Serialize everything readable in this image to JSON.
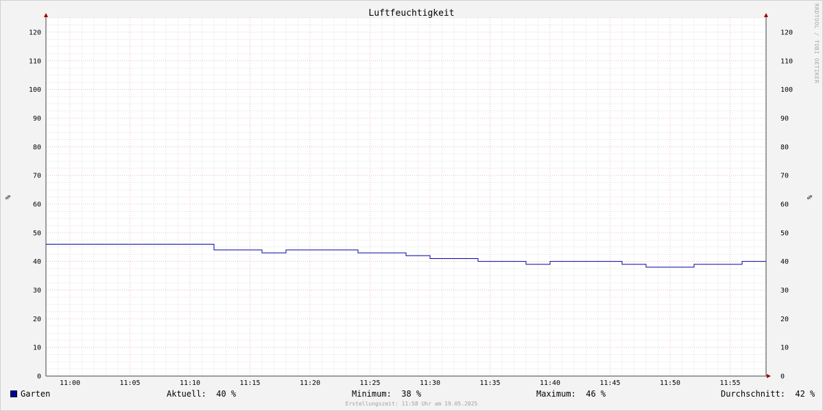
{
  "chart_data": {
    "type": "line",
    "title": "Luftfeuchtigkeit",
    "ylabel": "%",
    "ylabel_right": "%",
    "ylim": [
      0,
      125
    ],
    "yticks": [
      0,
      10,
      20,
      30,
      40,
      50,
      60,
      70,
      80,
      90,
      100,
      110,
      120
    ],
    "xlim": [
      "10:58",
      "11:58"
    ],
    "xticks": [
      "11:00",
      "11:05",
      "11:10",
      "11:15",
      "11:20",
      "11:25",
      "11:30",
      "11:35",
      "11:40",
      "11:45",
      "11:50",
      "11:55"
    ],
    "grid": true,
    "series": [
      {
        "name": "Garten",
        "color": "#0000a0",
        "step": true,
        "x": [
          "10:58",
          "11:12",
          "11:14",
          "11:16",
          "11:18",
          "11:24",
          "11:28",
          "11:30",
          "11:34",
          "11:38",
          "11:40",
          "11:46",
          "11:48",
          "11:52",
          "11:54",
          "11:56",
          "11:58"
        ],
        "values": [
          46,
          44,
          44,
          43,
          44,
          43,
          42,
          41,
          40,
          39,
          40,
          39,
          38,
          39,
          39,
          40,
          40
        ]
      }
    ]
  },
  "legend": {
    "series_name": "Garten",
    "current": "Aktuell:  40 %",
    "minimum": "Minimum:  38 %",
    "maximum": "Maximum:  46 %",
    "average": "Durchschnitt:  42 %"
  },
  "vertical_text": "RRDTOOL / TOBI OETIKER",
  "footer": "Erstellungszeit: 11:58 Uhr am 19.05.2025",
  "colors": {
    "line": "#0000a0",
    "major_grid": "#e8a0a0",
    "minor_grid": "#cfcfcf",
    "plot_bg": "#ffffff",
    "axis": "#404040",
    "arrow": "#a00000"
  }
}
